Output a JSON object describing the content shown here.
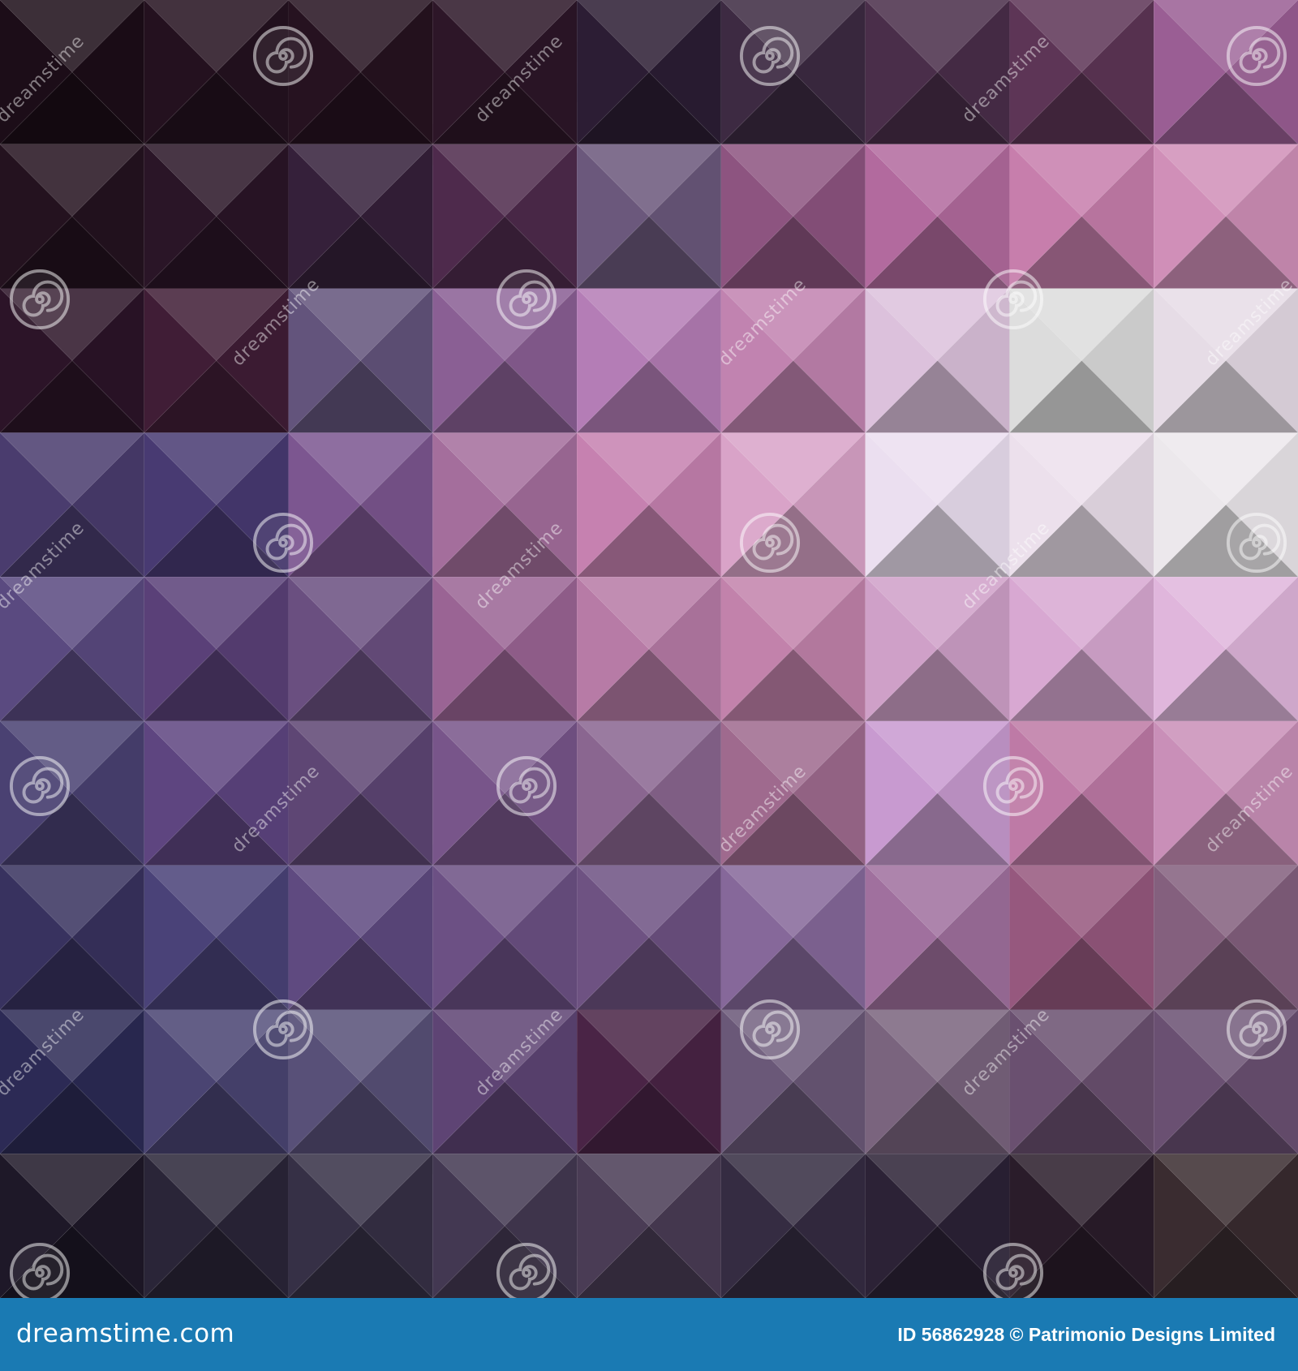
{
  "watermark": {
    "word": "dreamstime",
    "spiral_icon": "dreamstime-spiral-icon"
  },
  "footer": {
    "brand": "dreamstime.com",
    "credit": "ID 56862928 © Patrimonio Designs Limited",
    "background": "#1a7ab3",
    "text_color": "#ffffff"
  },
  "mosaic": {
    "rows": 9,
    "cols": 9,
    "tile_colors": [
      [
        "#1c0d18",
        "#24111f",
        "#261220",
        "#2d1628",
        "#2c1d34",
        "#3d2a42",
        "#4a2e4a",
        "#5d3556",
        "#9a5e94"
      ],
      [
        "#24121f",
        "#2a1527",
        "#35203a",
        "#4e2a4c",
        "#6b587c",
        "#8d5480",
        "#b26a9e",
        "#c77eac",
        "#d08fb8"
      ],
      [
        "#2c1428",
        "#401d36",
        "#63547c",
        "#8a5f94",
        "#b47db6",
        "#c183b0",
        "#dcc1dc",
        "#dcdcdc",
        "#e6dce6"
      ],
      [
        "#4a3c6e",
        "#483a72",
        "#7c5690",
        "#a46e9c",
        "#c681b0",
        "#d9a3c8",
        "#ebdff0",
        "#ece0ec",
        "#ece8ec"
      ],
      [
        "#5a4a80",
        "#5a4078",
        "#6a4f80",
        "#9a6494",
        "#b77ba6",
        "#c282ab",
        "#cfa0c8",
        "#d8a8d2",
        "#e0b6dc"
      ],
      [
        "#4a4172",
        "#5e4580",
        "#5e4674",
        "#78558a",
        "#8a6690",
        "#9f6a8e",
        "#c89ad0",
        "#be7aa6",
        "#c98fb8"
      ],
      [
        "#38325f",
        "#4a4278",
        "#5f4a80",
        "#6c5084",
        "#6e5282",
        "#86689a",
        "#a0709e",
        "#96587e",
        "#84607e"
      ],
      [
        "#2c2a55",
        "#4a4472",
        "#585078",
        "#5e4474",
        "#4a2446",
        "#6a5878",
        "#7a647e",
        "#6a5070",
        "#6a5072"
      ],
      [
        "#1e1828",
        "#2a2538",
        "#363046",
        "#433852",
        "#4a3c55",
        "#352c42",
        "#2c2236",
        "#2a1c2a",
        "#3a2c30"
      ]
    ]
  }
}
